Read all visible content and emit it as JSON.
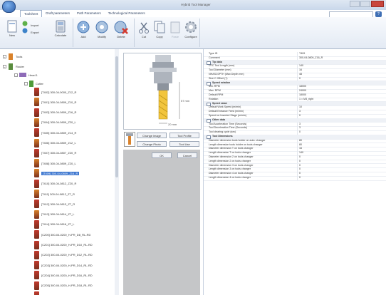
{
  "window": {
    "title": "Hybrid Tool Manager"
  },
  "tabs": [
    {
      "label": "Toolsheet"
    },
    {
      "label": "Draft parameters"
    },
    {
      "label": "Path Parameters"
    },
    {
      "label": "Technological Parameters"
    }
  ],
  "ribbon": {
    "buttons": [
      {
        "label": "New"
      },
      {
        "label": "Import"
      },
      {
        "label": "Export"
      },
      {
        "label": "Calculate"
      },
      {
        "label": "Add"
      },
      {
        "label": "Modify"
      },
      {
        "label": "Delete"
      },
      {
        "label": "Cut"
      },
      {
        "label": "Copy"
      },
      {
        "label": "Paste"
      },
      {
        "label": "Configure"
      }
    ]
  },
  "tree": {
    "root": "Tools",
    "group": "Router",
    "head": "Head 1",
    "folder": "Cutter",
    "items": [
      "[T402] 300-04-0000_Z12_R",
      "[T401] 300-04-0809_Z10_R",
      "[T403] 300-04-0809_Z16_R",
      "[T404] 300-04-0809_Z20_L",
      "[T405] 300-04-0809_Z14_R",
      "[T406] 300-04-0809_Z12_L",
      "[T407] 300-04-0807_Z20_R",
      "[T408] 300-04-0809_Z20_L",
      "[T409] 300-04-0809_Z16_R",
      "[T410] 300-04-0812_Z20_R",
      "[T411] 300-04-0812_Z7_R",
      "[T412] 300-04-0813_Z7_R",
      "[T413] 300-04-0814_Z7_L",
      "[T414] 300-04-0816_Z7_L",
      "[C200] 300-04-0200_H-PR_D8_RL-RD",
      "[C201] 300-04-0200_H-PR_D10_RL-RD",
      "[C202] 300-04-0200_H-PR_D12_RL-RD",
      "[C203] 300-04-0200_H-PR_D14_RL-RD",
      "[C204] 300-04-0200_H-PR_D16_RL-RD",
      "[C205] 300-04-0200_H-PR_D18_RL-RD",
      "[C206] 300-04-0200_H-PR_D20_RL-RD"
    ],
    "selected_index": 8
  },
  "preview": {
    "dim_length": "57 mm",
    "dim_diameter": "20 mm",
    "change_image_label": "Change image",
    "tool_profile_label": "Tool Profile",
    "change_photo_label": "Change Photo",
    "tool_use_label": "Tool Use",
    "ok_label": "OK",
    "cancel_label": "Cancel"
  },
  "props": [
    {
      "k": "Type ID",
      "v": "T409"
    },
    {
      "k": "Comment",
      "v": "300-04-0809_Z16_R"
    },
    {
      "k": "Tip data",
      "v": "",
      "cat": true
    },
    {
      "k": "UTC Tool Length (mm)",
      "v": "140"
    },
    {
      "k": "Tool Diameter (mm)",
      "v": "16"
    },
    {
      "k": "NHASC0PTH (Max Depth mm)",
      "v": "48"
    },
    {
      "k": "Size C Offset (?)",
      "v": "0"
    },
    {
      "k": "Speed rotation",
      "v": "",
      "cat": true
    },
    {
      "k": "Min. RPM",
      "v": "18000"
    },
    {
      "k": "Max. RPM",
      "v": "24000"
    },
    {
      "k": "Default RPM",
      "v": "18000"
    },
    {
      "k": "Rotation",
      "v": "1 = M3_right"
    },
    {
      "k": "Speed value",
      "v": "",
      "cat": true
    },
    {
      "k": "Default Work Speed (m/min)",
      "v": "10"
    },
    {
      "k": "Default Entrance Feed (m/min)",
      "v": "3"
    },
    {
      "k": "Speed on Inserted Stage (m/min)",
      "v": "0"
    },
    {
      "k": "Other data",
      "v": "",
      "cat": true
    },
    {
      "k": "Tool Acceleration Time (Seconds)",
      "v": "3"
    },
    {
      "k": "Tool Deceleration Time (Seconds)",
      "v": "3"
    },
    {
      "k": "Tool clearing cycle (sec)",
      "v": "0"
    },
    {
      "k": "Tool Dimensions",
      "v": "",
      "cat": true
    },
    {
      "k": "Diameter dimension tools holder on auto. changer",
      "v": "80"
    },
    {
      "k": "Length dimension tools holder on tools changer",
      "v": "80"
    },
    {
      "k": "Diameter dimension T on tools changer",
      "v": "16"
    },
    {
      "k": "Length dimension T on tools changer",
      "v": "140"
    },
    {
      "k": "Diameter dimension 2 on tools changer",
      "v": "0"
    },
    {
      "k": "Length dimension 2 on tools changer",
      "v": "0"
    },
    {
      "k": "Diameter dimension 3 on tools changer",
      "v": "0"
    },
    {
      "k": "Length dimension 3 on tools changer",
      "v": "0"
    },
    {
      "k": "Diameter dimension 4 on tools changer",
      "v": "0"
    },
    {
      "k": "Length dimension 4 on tools changer",
      "v": "0"
    }
  ]
}
